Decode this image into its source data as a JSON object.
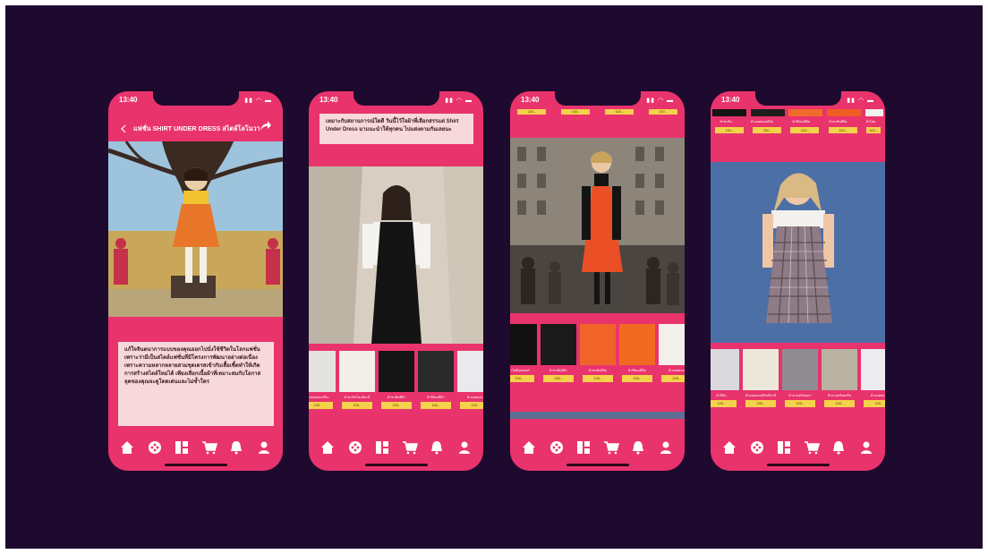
{
  "status_time": "13:40",
  "phone1": {
    "title": "แฟชั่น SHIRT UNDER DRESS สไตล์โลโนวา",
    "back_icon": "chevron-left-icon",
    "share_icon": "share-icon",
    "body_text": "แก้ใจจินตนาการแบบของคุณออกไปนั่งใช้ชีวิตในโลกแฟชั่น เพราะว่ามีเป็นสไตล์แฟชั่นที่มีโครงการพัฒนาอย่างต่อเนื่อง เพราะความหลากหลายสวมชุดเดรสเข้ากับเสื้อเชิ้ตทำให้เกิดการสร้างสไตล์ใหม่ได้ เพียงเลือกเนื้อผ้าที่เหมาะสมกับโอกาส ลุคของคุณจะดูโดดเด่นและไม่ซ้ำใคร"
  },
  "phone2": {
    "top_text": "เหมาะกับสถานการณ์ใดดี วันนี้ไว้ใจผ้าที่เลือกสรรแต่ Shirt Under Dress มาแนะนำให้ทุกคน ไปแต่งตามกันเลยนะ",
    "swatches": [
      {
        "caption": "ผ้าคอตตอนลินิน",
        "price": "100.-",
        "color": "#e4e2de"
      },
      {
        "caption": "ผ้าซาตินไหมอิตาลี",
        "price": "100.-",
        "color": "#f1efe8"
      },
      {
        "caption": "ผ้าซาตินสีดำ",
        "price": "100.-",
        "color": "#151515"
      },
      {
        "caption": "ผ้าชีฟองสีดำ",
        "price": "100.-",
        "color": "#2a2a2a"
      },
      {
        "caption": "ผ้าคอตตอน",
        "price": "100.-",
        "color": "#e9e9ee"
      }
    ]
  },
  "phone3": {
    "top_prices": [
      "100.-",
      "100.-",
      "100.-",
      "100.-"
    ],
    "swatches": [
      {
        "caption": "ผ้าโพลีเอสเตอร์",
        "price": "100.-",
        "color": "#111111"
      },
      {
        "caption": "ผ้าซาตินสีดำ",
        "price": "200.-",
        "color": "#1a1a1a"
      },
      {
        "caption": "ผ้าซาตินสีส้ม",
        "price": "100.-",
        "color": "#f0642a"
      },
      {
        "caption": "ผ้าชีฟองสีส้ม",
        "price": "100.-",
        "color": "#f26a22"
      },
      {
        "caption": "ผ้าคอตตอน",
        "price": "100.-",
        "color": "#f3efe9"
      }
    ]
  },
  "phone4": {
    "top_captions": [
      "ผ้าซาติน",
      "ผ้าคอตตอนลินิน",
      "ผ้าชีฟองสีส้ม",
      "ผ้าซาตินสีส้ม",
      "ผ้าไหม"
    ],
    "top_prices": [
      "100.-",
      "200.-",
      "100.-",
      "100.-",
      "300.-"
    ],
    "swatches": [
      {
        "caption": "ผ้าลินิน",
        "price": "100.-",
        "color": "#d9d9de"
      },
      {
        "caption": "ผ้าคอตตอนลินินอิตาลี",
        "price": "200.-",
        "color": "#ece8da"
      },
      {
        "caption": "ผ้าลายสก๊อตเทา",
        "price": "100.-",
        "color": "#8f8d92"
      },
      {
        "caption": "ผ้าลายสก๊อตครีม",
        "price": "100.-",
        "color": "#b9b2a2"
      },
      {
        "caption": "ผ้าคอตตอน",
        "price": "100.-",
        "color": "#ebebf0"
      }
    ]
  },
  "tabbar": [
    "home-icon",
    "apps-icon",
    "categories-icon",
    "cart-icon",
    "bell-icon",
    "profile-icon"
  ]
}
